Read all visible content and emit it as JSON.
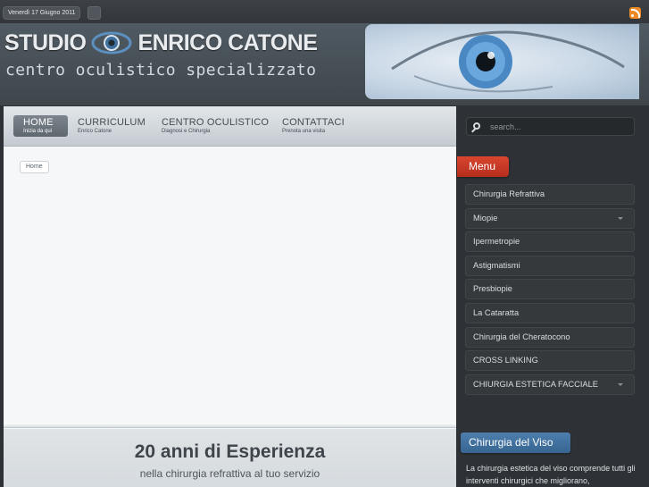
{
  "topbar": {
    "date": "Venerdì 17 Giugno 2011"
  },
  "header": {
    "logo_left": "STUDIO",
    "logo_right": "ENRICO CATONE",
    "tagline": "centro oculistico specializzato"
  },
  "nav": {
    "items": [
      {
        "label": "HOME",
        "sub": "Inizia da qui"
      },
      {
        "label": "CURRICULUM",
        "sub": "Enrico Catone"
      },
      {
        "label": "CENTRO OCULISTICO",
        "sub": "Diagnosi e Chirurgia"
      },
      {
        "label": "CONTATTACI",
        "sub": "Prenota una visita"
      }
    ]
  },
  "breadcrumb": "Home",
  "main": {
    "title": "20 anni di Esperienza",
    "subtitle": "nella chirurgia refrattiva al tuo servizio"
  },
  "search": {
    "placeholder": "search..."
  },
  "sidebar": {
    "menu_title": "Menu",
    "items": [
      {
        "label": "Chirurgia Refrattiva"
      },
      {
        "label": "Miopie"
      },
      {
        "label": "Ipermetropie"
      },
      {
        "label": "Astigmatismi"
      },
      {
        "label": "Presbiopie"
      },
      {
        "label": "La Cataratta"
      },
      {
        "label": "Chirurgia del Cheratocono"
      },
      {
        "label": "CROSS LINKING"
      },
      {
        "label": "CHIURGIA ESTETICA FACCIALE"
      }
    ],
    "section_title": "Chirurgia del Viso",
    "section_text": "La chirurgia estetica del viso comprende tutti gli interventi chirurgici che migliorano,"
  },
  "colors": {
    "menu_accent": "#c4372a",
    "section_accent": "#4477a6",
    "rss": "#f08a24"
  }
}
